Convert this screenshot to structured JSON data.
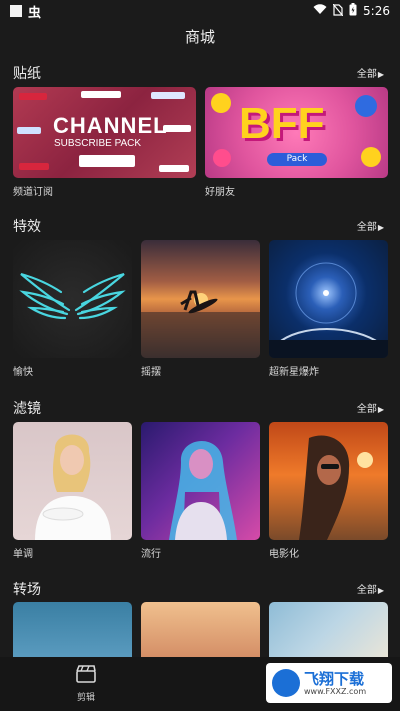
{
  "status_bar": {
    "app_glyph": "虫",
    "time": "5:26",
    "icons": [
      "wifi-icon",
      "no-sim-icon",
      "battery-icon"
    ]
  },
  "header": {
    "title": "商城"
  },
  "sections": {
    "stickers": {
      "title": "贴纸",
      "all_label": "全部",
      "items": [
        {
          "label": "频道订阅",
          "art_title": "CHANNEL",
          "art_subtitle": "SUBSCRIBE PACK"
        },
        {
          "label": "好朋友",
          "art_title": "BFF",
          "art_subtitle": "Pack"
        }
      ]
    },
    "effects": {
      "title": "特效",
      "all_label": "全部",
      "items": [
        {
          "label": "愉快"
        },
        {
          "label": "摇摆"
        },
        {
          "label": "超新星爆炸"
        }
      ]
    },
    "filters": {
      "title": "滤镜",
      "all_label": "全部",
      "items": [
        {
          "label": "单调"
        },
        {
          "label": "流行"
        },
        {
          "label": "电影化"
        }
      ]
    },
    "transitions": {
      "title": "转场",
      "all_label": "全部"
    }
  },
  "bottom_nav": {
    "edit_label": "剪辑"
  },
  "watermark": {
    "text": "飞翔下载",
    "url": "www.FXXZ.com"
  }
}
